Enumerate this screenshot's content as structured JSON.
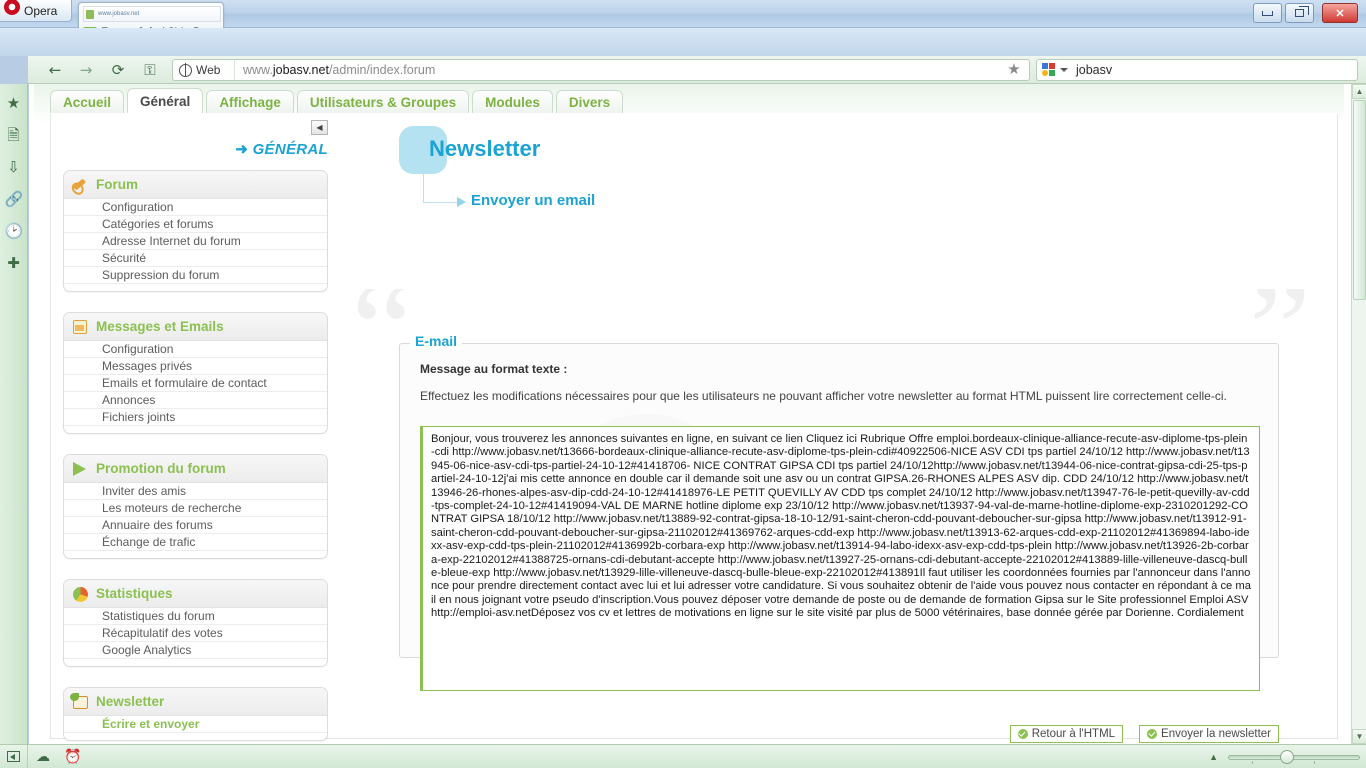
{
  "browser": {
    "opera_label": "Opera",
    "tab": {
      "thumb_url": "www.jobasv.net",
      "title": "Forum Job-ASV - Bi...",
      "close_label": "✕"
    },
    "new_tab_label": "+",
    "window_controls": {
      "minimize": "",
      "restore": "",
      "close": "✕"
    },
    "nav": {
      "back": "←",
      "forward": "→",
      "reload": "⟳",
      "key": "⚿"
    },
    "url": {
      "scope_label": "Web",
      "prefix": "www.",
      "host": "jobasv.net",
      "path": "/admin/index.forum"
    },
    "bookmark_star": "★",
    "search": {
      "engine": "google-icon",
      "value": "jobasv"
    },
    "panel_icons": [
      "star-icon",
      "notes-icon",
      "downloads-icon",
      "links-icon",
      "history-icon",
      "add-panel-icon"
    ]
  },
  "statusbar": {
    "panel_toggle": "panel-toggle-icon",
    "icons": [
      "cloud-icon",
      "speedometer-icon"
    ],
    "zoom_up": "▲"
  },
  "admin": {
    "tabs": [
      {
        "label": "Accueil",
        "active": false
      },
      {
        "label": "Général",
        "active": true
      },
      {
        "label": "Affichage",
        "active": false
      },
      {
        "label": "Utilisateurs & Groupes",
        "active": false
      },
      {
        "label": "Modules",
        "active": false
      },
      {
        "label": "Divers",
        "active": false
      }
    ],
    "collapse_label": "◀",
    "section_label": "GÉNÉRAL",
    "section_arrow": "➜",
    "sidebar": [
      {
        "title": "Forum",
        "icon": "wrench-icon",
        "items": [
          "Configuration",
          "Catégories et forums",
          "Adresse Internet du forum",
          "Sécurité",
          "Suppression du forum"
        ]
      },
      {
        "title": "Messages et Emails",
        "icon": "mail-icon",
        "items": [
          "Configuration",
          "Messages privés",
          "Emails et formulaire de contact",
          "Annonces",
          "Fichiers joints"
        ]
      },
      {
        "title": "Promotion du forum",
        "icon": "promo-icon",
        "items": [
          "Inviter des amis",
          "Les moteurs de recherche",
          "Annuaire des forums",
          "Échange de trafic"
        ]
      },
      {
        "title": "Statistiques",
        "icon": "pie-chart-icon",
        "items": [
          "Statistiques du forum",
          "Récapitulatif des votes",
          "Google Analytics"
        ]
      },
      {
        "title": "Newsletter",
        "icon": "newsletter-icon",
        "items": [
          "Écrire et envoyer"
        ]
      }
    ]
  },
  "main": {
    "title": "Newsletter",
    "subtitle": "Envoyer un email",
    "fieldset_legend": "E-mail",
    "message_label": "Message au format texte :",
    "message_description": "Effectuez les modifications nécessaires pour que les utilisateurs ne pouvant afficher votre newsletter au format HTML puissent lire correctement celle-ci.",
    "textarea_value": "Bonjour, vous trouverez les annonces suivantes en ligne, en suivant ce lien Cliquez ici Rubrique Offre emploi.bordeaux-clinique-alliance-recute-asv-diplome-tps-plein-cdi http://www.jobasv.net/t13666-bordeaux-clinique-alliance-recute-asv-diplome-tps-plein-cdi#40922506-NICE ASV CDI tps partiel 24/10/12 http://www.jobasv.net/t13945-06-nice-asv-cdi-tps-partiel-24-10-12#41418706- NICE CONTRAT GIPSA CDI tps partiel 24/10/12http://www.jobasv.net/t13944-06-nice-contrat-gipsa-cdi-25-tps-partiel-24-10-12j'ai mis cette annonce en double car il demande soit une asv ou un contrat GIPSA.26-RHONES ALPES ASV dip. CDD 24/10/12 http://www.jobasv.net/t13946-26-rhones-alpes-asv-dip-cdd-24-10-12#41418976-LE PETIT QUEVILLY AV CDD tps complet 24/10/12 http://www.jobasv.net/t13947-76-le-petit-quevilly-av-cdd-tps-complet-24-10-12#41419094-VAL DE MARNE hotline diplome exp 23/10/12 http://www.jobasv.net/t13937-94-val-de-marne-hotline-diplome-exp-2310201292-CONTRAT GIPSA 18/10/12 http://www.jobasv.net/t13889-92-contrat-gipsa-18-10-12/91-saint-cheron-cdd-pouvant-deboucher-sur-gipsa http://www.jobasv.net/t13912-91-saint-cheron-cdd-pouvant-deboucher-sur-gipsa-21102012#41369762-arques-cdd-exp http://www.jobasv.net/t13913-62-arques-cdd-exp-21102012#41369894-labo-idexx-asv-exp-cdd-tps-plein-21102012#4136992b-corbara-exp http://www.jobasv.net/t13914-94-labo-idexx-asv-exp-cdd-tps-plein http://www.jobasv.net/t13926-2b-corbara-exp-22102012#41388725-ornans-cdi-debutant-accepte http://www.jobasv.net/t13927-25-ornans-cdi-debutant-accepte-22102012#413889-lille-villeneuve-dascq-bulle-bleue-exp http://www.jobasv.net/t13929-lille-villeneuve-dascq-bulle-bleue-exp-22102012#413891Il faut utiliser les coordonnées fournies par l'annonceur dans l'annonce pour prendre directement contact avec lui et lui adresser votre candidature. Si vous souhaitez obtenir de l'aide vous pouvez nous contacter en répondant à ce mail en nous joignant votre pseudo d'inscription.Vous pouvez déposer votre demande de poste ou de demande de formation  Gipsa sur le Site professionnel Emploi ASV http://emploi-asv.netDéposez vos cv et lettres de motivations en ligne sur le site visité par plus de 5000 vétérinaires, base donnée gérée par Dorienne. Cordialement",
    "buttons": [
      {
        "label": "Retour à l'HTML",
        "name": "back-to-html-button"
      },
      {
        "label": "Envoyer la newsletter",
        "name": "send-newsletter-button"
      }
    ],
    "quote_open": "“",
    "quote_close": "”"
  },
  "colors": {
    "accent_green": "#8cc152",
    "accent_blue": "#1ba3d4",
    "chrome_green": "#dcebdd"
  }
}
